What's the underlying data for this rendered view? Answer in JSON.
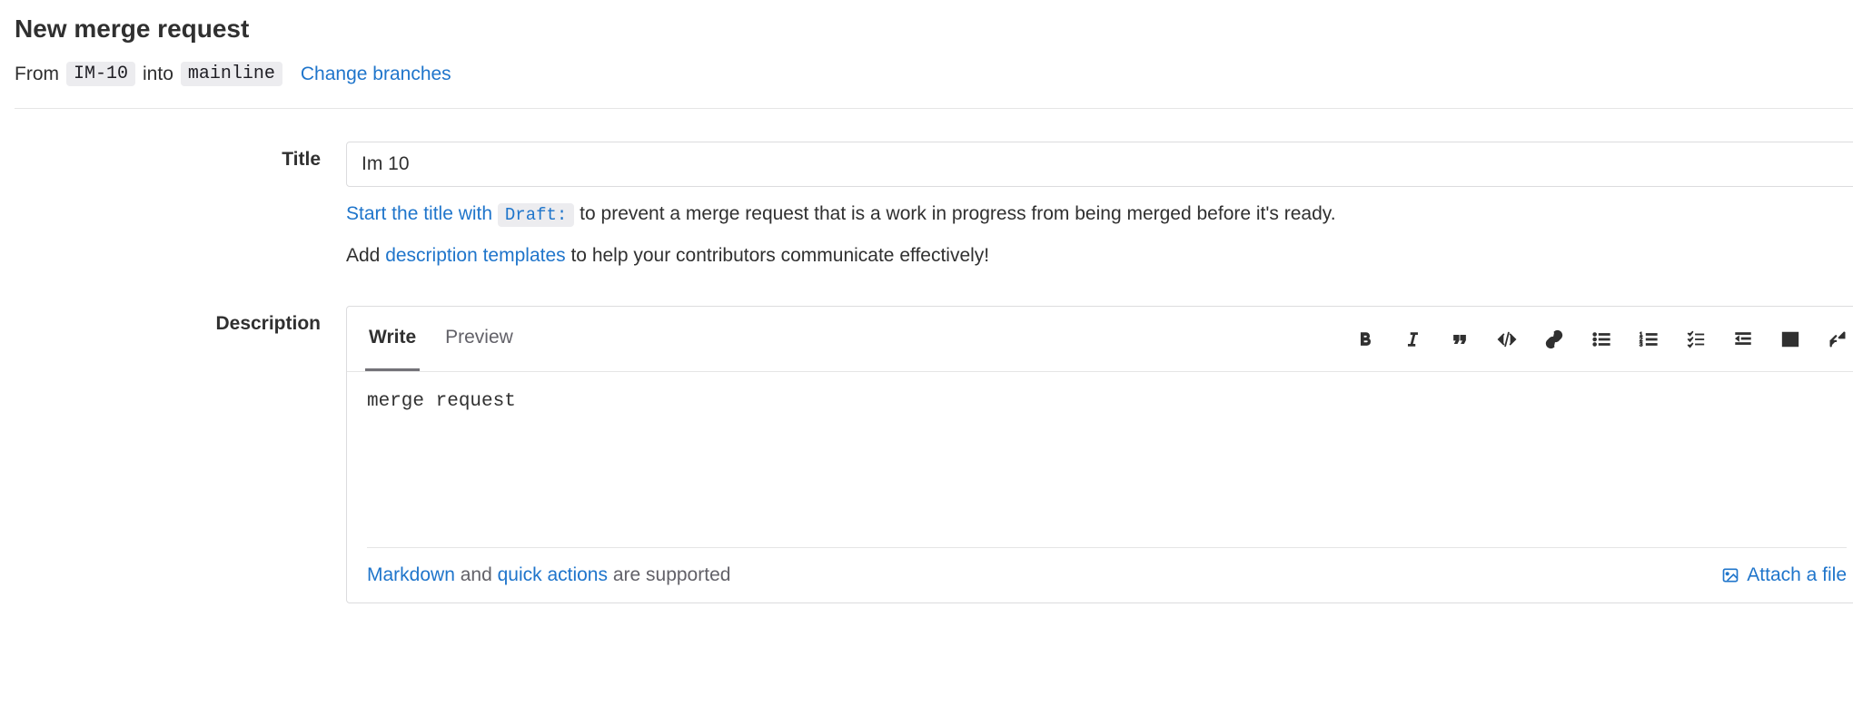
{
  "header": {
    "title": "New merge request"
  },
  "branches": {
    "from_text": "From",
    "from_branch": "IM-10",
    "into_text": "into",
    "into_branch": "mainline",
    "change_link": "Change branches"
  },
  "title_field": {
    "label": "Title",
    "value": "Im 10",
    "draft_hint_prefix": "Start the title with ",
    "draft_code": "Draft:",
    "draft_hint_suffix": " to prevent a merge request that is a work in progress from being merged before it's ready.",
    "template_hint_prefix": "Add ",
    "template_link": "description templates",
    "template_hint_suffix": " to help your contributors communicate effectively!"
  },
  "description_field": {
    "label": "Description",
    "tabs": {
      "write": "Write",
      "preview": "Preview"
    },
    "value": "merge request",
    "footer": {
      "markdown_link": "Markdown",
      "and_text": " and ",
      "quick_actions_link": "quick actions",
      "supported_text": " are supported"
    },
    "attach_file": "Attach a file"
  }
}
